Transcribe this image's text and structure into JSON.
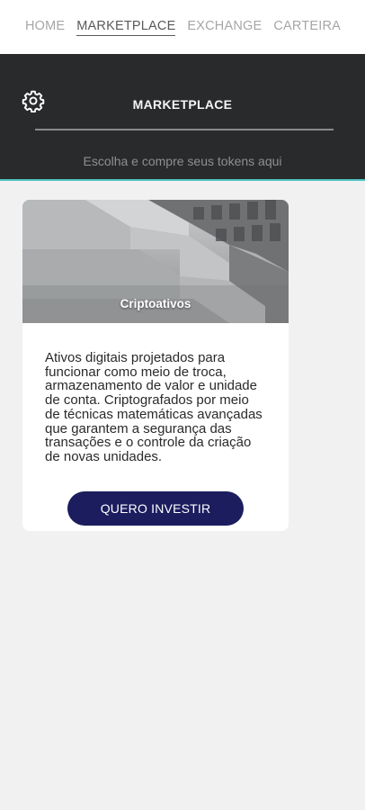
{
  "nav": {
    "items": [
      {
        "label": "HOME",
        "active": false
      },
      {
        "label": "MARKETPLACE",
        "active": true
      },
      {
        "label": "EXCHANGE",
        "active": false
      },
      {
        "label": "CARTEIRA",
        "active": false
      }
    ]
  },
  "header": {
    "title": "MARKETPLACE",
    "subtitle": "Escolha e compre seus tokens aqui",
    "settings_icon": "gear-icon",
    "accent_color": "#4fc3c1",
    "background_color": "#292a2c"
  },
  "card": {
    "image_title": "Criptoativos",
    "description": "Ativos digitais projetados para funcionar como meio de troca, armazenamento de valor e unidade de conta. Criptografados por meio de técnicas matemáticas avançadas que garantem a segurança das transações e o controle da criação de novas unidades.",
    "button_label": "QUERO INVESTIR",
    "button_color": "#1b1d5e"
  }
}
